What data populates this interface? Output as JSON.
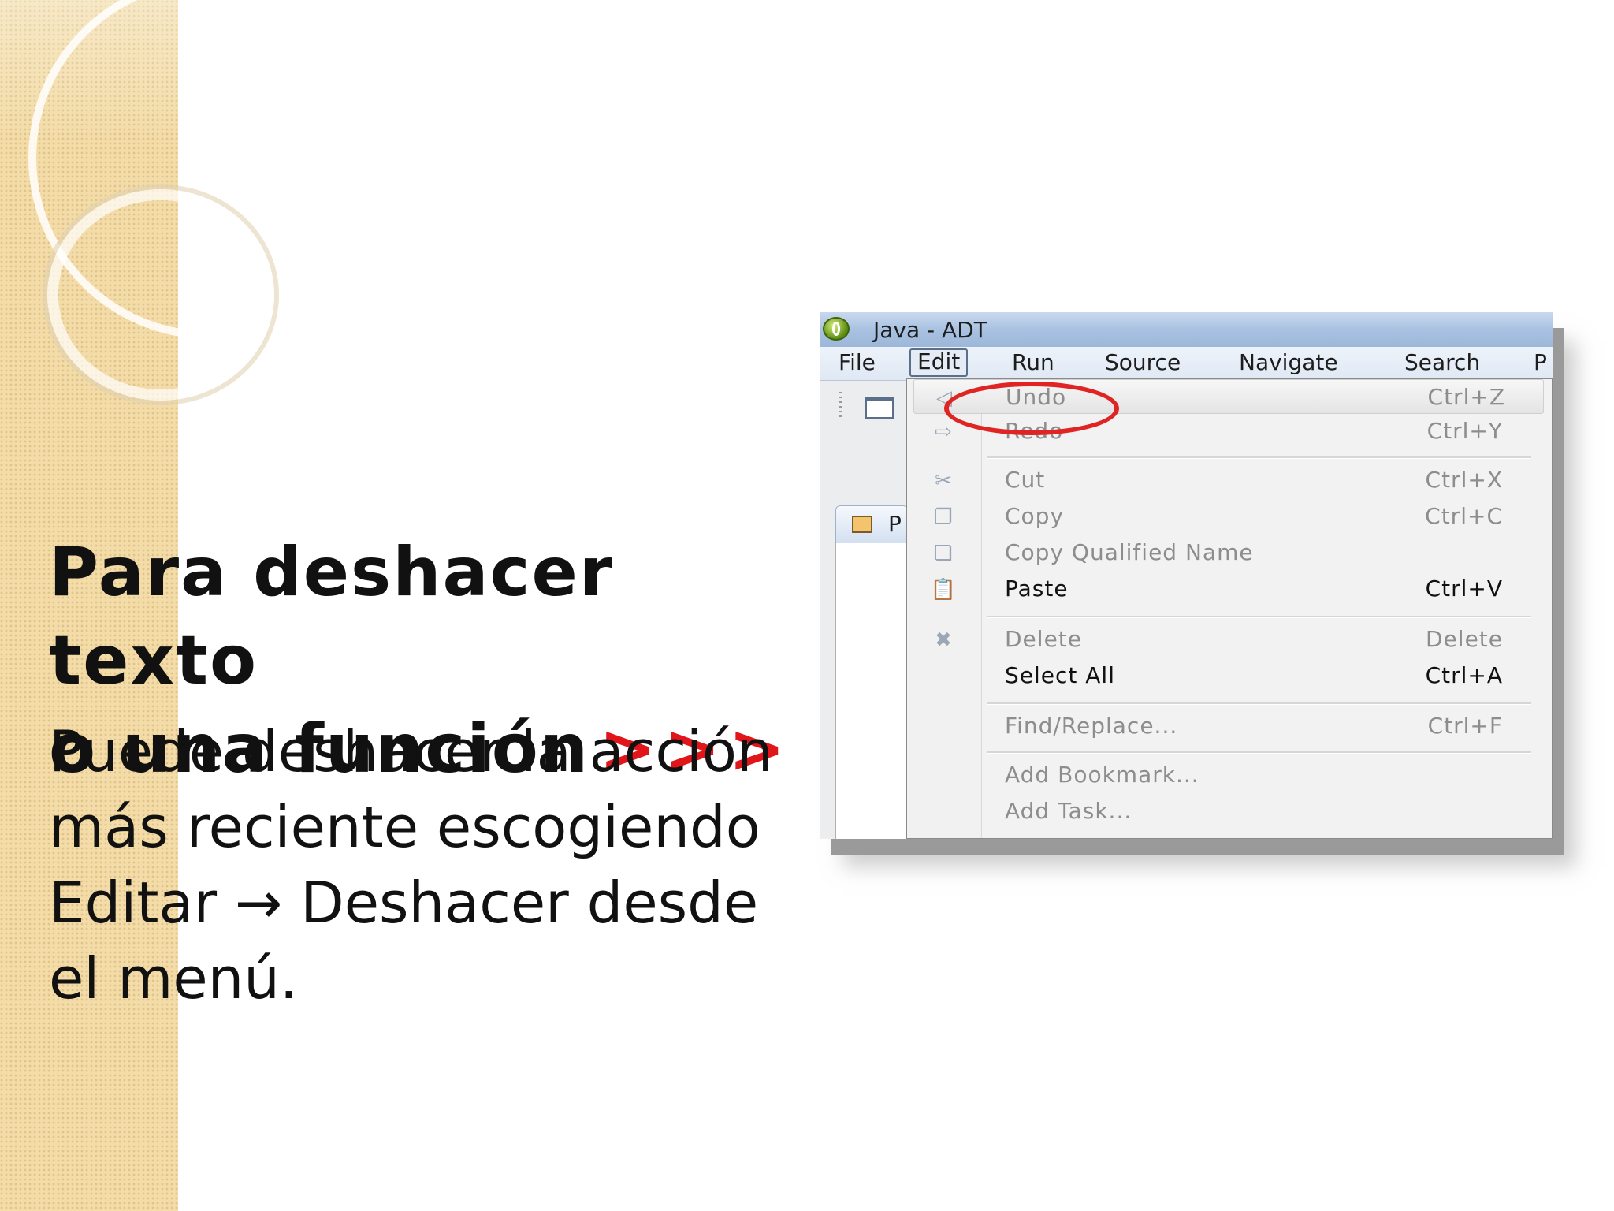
{
  "slide": {
    "title_line1": "Para deshacer texto",
    "title_line2": "o una función",
    "title_arrows": ">>>",
    "body_line1": "Puede deshacer la acción",
    "body_line2": "más reciente escogiendo",
    "body_line3": "Editar → Deshacer desde",
    "body_line4": "el menú."
  },
  "window": {
    "title": "Java - ADT"
  },
  "menubar": {
    "items": [
      "File",
      "Edit",
      "Run",
      "Source",
      "Navigate",
      "Search",
      "P"
    ],
    "active": "Edit"
  },
  "view_tab": {
    "label": "P"
  },
  "edit_menu": {
    "items": [
      {
        "label": "Undo",
        "shortcut": "Ctrl+Z",
        "enabled": false,
        "icon": "undo-icon"
      },
      {
        "label": "Redo",
        "shortcut": "Ctrl+Y",
        "enabled": false,
        "icon": "redo-icon"
      },
      {
        "label": "Cut",
        "shortcut": "Ctrl+X",
        "enabled": false,
        "icon": "scissors-icon"
      },
      {
        "label": "Copy",
        "shortcut": "Ctrl+C",
        "enabled": false,
        "icon": "copy-icon"
      },
      {
        "label": "Copy Qualified Name",
        "shortcut": "",
        "enabled": false,
        "icon": "copy-qualified-icon"
      },
      {
        "label": "Paste",
        "shortcut": "Ctrl+V",
        "enabled": true,
        "icon": "paste-icon"
      },
      {
        "label": "Delete",
        "shortcut": "Delete",
        "enabled": false,
        "icon": "delete-icon"
      },
      {
        "label": "Select All",
        "shortcut": "Ctrl+A",
        "enabled": true,
        "icon": ""
      },
      {
        "label": "Find/Replace...",
        "shortcut": "Ctrl+F",
        "enabled": false,
        "icon": ""
      },
      {
        "label": "Add Bookmark...",
        "shortcut": "",
        "enabled": false,
        "icon": ""
      },
      {
        "label": "Add Task...",
        "shortcut": "",
        "enabled": false,
        "icon": ""
      }
    ]
  },
  "colors": {
    "accent_red": "#e0161a",
    "sidebar_tan": "#f3dca8",
    "highlight_ring": "#e02424"
  }
}
